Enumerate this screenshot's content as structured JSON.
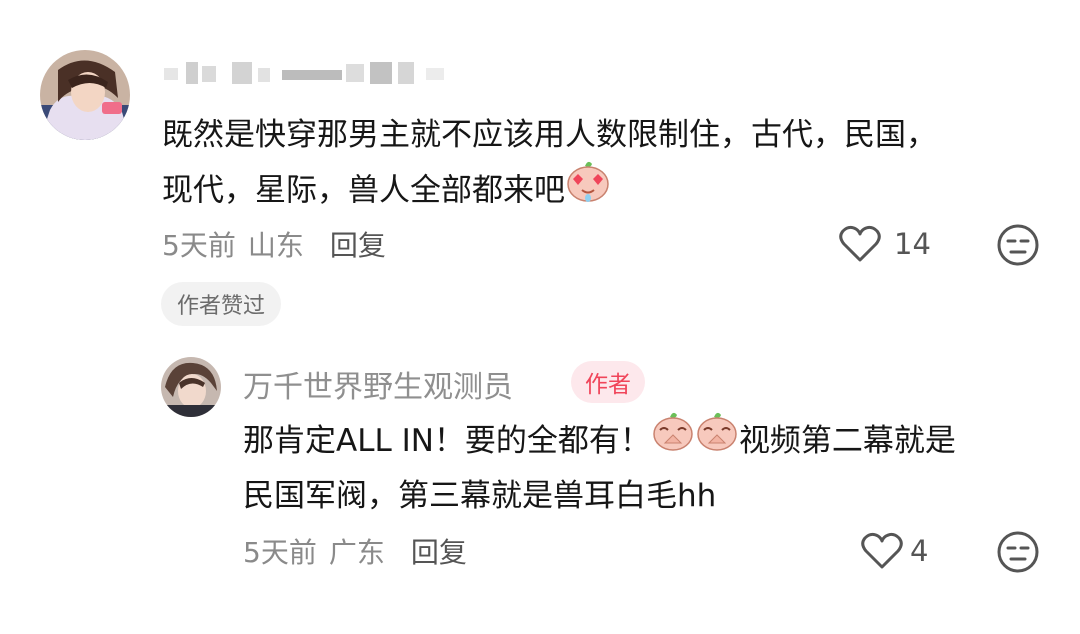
{
  "comment": {
    "avatar_icon": "user-avatar-anime-boy",
    "username": "",
    "text_line1": "既然是快穿那男主就不应该用人数限制住，古代，民国，",
    "text_line2": "现代，星际，兽人全部都来吧",
    "emoji": "heart-eyes-peach-emoji",
    "time": "5天前",
    "region": "山东",
    "reply_label": "回复",
    "like_count": "14",
    "author_liked_badge": "作者赞过"
  },
  "reply": {
    "avatar_icon": "author-avatar-anime-boy",
    "username": "万千世界野生观测员",
    "author_tag": "作者",
    "text_line1_a": "那肯定ALL IN！要的全都有！",
    "text_line1_b": "视频第二幕就是",
    "text_line2": "民国军阀，第三幕就是兽耳白毛hh",
    "emoji": "praying-peach-emoji",
    "time": "5天前",
    "region": "广东",
    "reply_label": "回复",
    "like_count": "4"
  },
  "colors": {
    "text": "#161616",
    "meta": "#8a8a8a",
    "author_tag_bg": "#fde8ec",
    "author_tag_text": "#f0455a",
    "badge_bg": "#f2f2f2"
  }
}
